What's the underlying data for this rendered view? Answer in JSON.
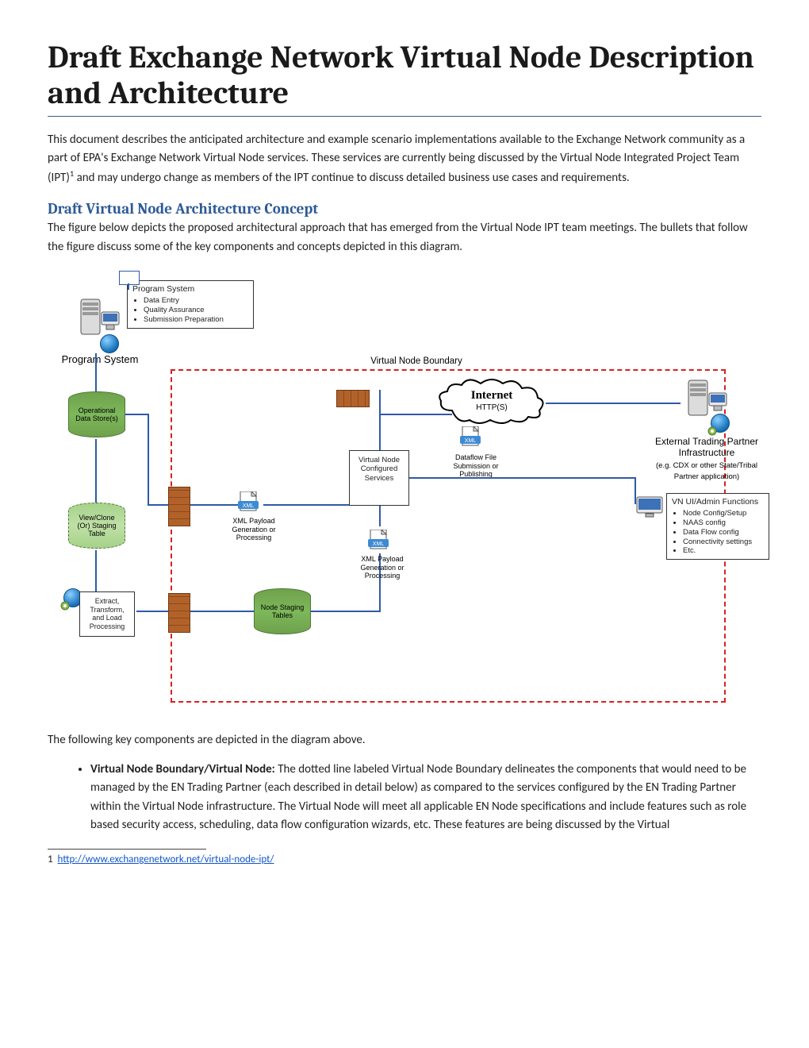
{
  "title": "Draft Exchange Network Virtual Node Description and Architecture",
  "intro": "This document describes the anticipated architecture and example scenario implementations available to the Exchange Network community as a part of EPA's Exchange Network Virtual Node services. These services are currently being discussed by the Virtual Node Integrated Project Team (IPT)",
  "intro_after_fn": " and may undergo change as members of the IPT continue to discuss detailed business use cases and requirements.",
  "fn_marker": "1",
  "section1": {
    "heading": "Draft Virtual Node Architecture Concept",
    "para": "The figure below depicts the proposed architectural approach that has emerged from the Virtual Node IPT team meetings. The bullets that follow the figure discuss some of the key components and concepts depicted in this diagram."
  },
  "diagram": {
    "boundary_label": "Virtual Node Boundary",
    "program_system": "Program System",
    "ps_box": {
      "title": "Program System",
      "items": [
        "Data Entry",
        "Quality Assurance",
        "Submission Preparation"
      ]
    },
    "ods": "Operational Data Store(s)",
    "view_clone": "View/Clone (Or) Staging Table",
    "etl": "Extract, Transform, and Load Processing",
    "node_staging": "Node Staging Tables",
    "xml_gen_1": "XML Payload Generation or Processing",
    "xml_gen_2": "XML Payload Generation or Processing",
    "vn_services": "Virtual Node Configured Services",
    "dataflow_file": "Dataflow File Submission or Publishing",
    "internet": "Internet",
    "internet_sub": "HTTP(S)",
    "ext_partner": "External Trading Partner Infrastructure",
    "ext_partner_sub": "(e.g. CDX or other State/Tribal Partner application)",
    "admin_box": {
      "title": "VN UI/Admin Functions",
      "items": [
        "Node Config/Setup",
        "NAAS config",
        "Data Flow config",
        "Connectivity settings",
        "Etc."
      ]
    }
  },
  "post_diagram": "The following key components are depicted in the diagram above.",
  "bullet1": {
    "head": "Virtual Node Boundary/Virtual Node: ",
    "body": "The dotted line labeled Virtual Node Boundary delineates the components that would need to be managed by the EN Trading Partner (each described in detail below) as compared to the services configured by the EN Trading Partner within the Virtual Node infrastructure. The Virtual Node will meet all applicable EN Node specifications and include features such as role based security access, scheduling, data flow configuration wizards, etc. These features are being discussed by the Virtual"
  },
  "footnote": {
    "num": "1",
    "link_text": "http://www.exchangenetwork.net/virtual-node-ipt/"
  }
}
